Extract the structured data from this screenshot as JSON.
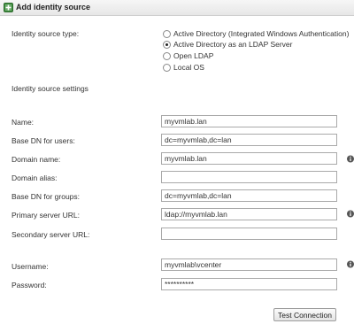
{
  "window": {
    "title": "Add identity source"
  },
  "source_type": {
    "label": "Identity source type:",
    "options": [
      {
        "label": "Active Directory (Integrated Windows Authentication)",
        "selected": false
      },
      {
        "label": "Active Directory as an LDAP Server",
        "selected": true
      },
      {
        "label": "Open LDAP",
        "selected": false
      },
      {
        "label": "Local OS",
        "selected": false
      }
    ]
  },
  "settings": {
    "heading": "Identity source settings",
    "fields": [
      {
        "label": "Name:",
        "value": "myvmlab.lan"
      },
      {
        "label": "Base DN for users:",
        "value": "dc=myvmlab,dc=lan"
      },
      {
        "label": "Domain name:",
        "value": "myvmlab.lan"
      },
      {
        "label": "Domain alias:",
        "value": ""
      },
      {
        "label": "Base DN for groups:",
        "value": "dc=myvmlab,dc=lan"
      },
      {
        "label": "Primary server URL:",
        "value": "ldap://myvmlab.lan"
      },
      {
        "label": "Secondary server URL:",
        "value": ""
      },
      {
        "label": "Username:",
        "value": "myvmlab\\vcenter"
      },
      {
        "label": "Password:",
        "value": "**********"
      }
    ]
  },
  "actions": {
    "test_connection": "Test Connection"
  },
  "icons": {
    "title": "add-identity-source-icon",
    "info": "info-icon"
  }
}
